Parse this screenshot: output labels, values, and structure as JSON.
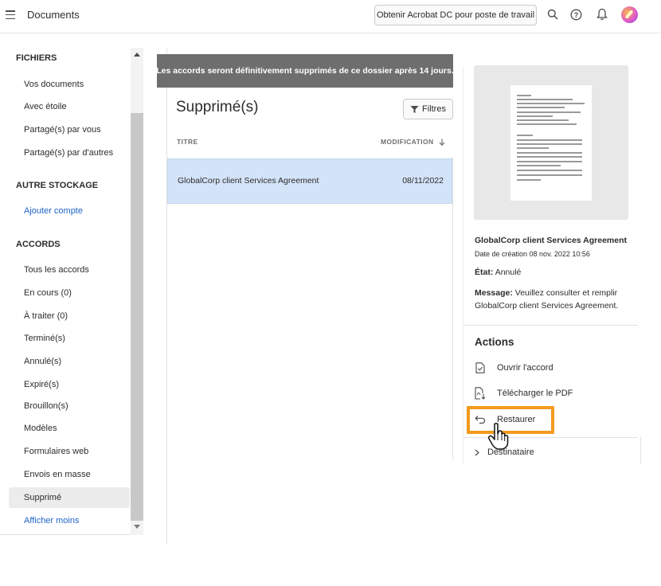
{
  "header": {
    "title": "Documents",
    "get_acrobat_label": "Obtenir Acrobat DC pour poste de travail",
    "icons": [
      "menu-icon",
      "search-icon",
      "help-icon",
      "bell-icon",
      "avatar"
    ]
  },
  "sidebar": {
    "sections": [
      {
        "title": "FICHIERS",
        "items": [
          "Vos documents",
          "Avec étoile",
          "Partagé(s) par vous",
          "Partagé(s) par d'autres"
        ]
      },
      {
        "title": "AUTRE STOCKAGE",
        "items": [
          "Ajouter compte"
        ]
      },
      {
        "title": "ACCORDS",
        "items": [
          "Tous les accords",
          "En cours (0)",
          "À traiter (0)",
          "Terminé(s)",
          "Annulé(s)",
          "Expiré(s)",
          "Brouillon(s)",
          "Modèles",
          "Formulaires web",
          "Envois en masse",
          "Supprimé",
          "Afficher moins"
        ]
      }
    ],
    "selected_item": "Supprimé"
  },
  "main": {
    "banner": "Les accords seront définitivement supprimés de ce dossier après 14 jours.",
    "title": "Supprimé(s)",
    "filter_label": "Filtres",
    "columns": {
      "title": "TITRE",
      "modified": "MODIFICATION"
    },
    "rows": [
      {
        "name": "GlobalCorp client Services Agreement",
        "date": "08/11/2022",
        "selected": true
      }
    ]
  },
  "details": {
    "name": "GlobalCorp client Services Agreement",
    "created": "Date de création 08 nov. 2022 10:56",
    "state_label": "État:",
    "state_value": "Annulé",
    "message_label": "Message:",
    "message_value": "Veuillez consulter et remplir GlobalCorp client Services Agreement.",
    "actions_title": "Actions",
    "actions": [
      {
        "label": "Ouvrir l'accord",
        "icon": "document-check-icon"
      },
      {
        "label": "Télécharger le PDF",
        "icon": "pdf-download-icon"
      },
      {
        "label": "Restaurer",
        "icon": "restore-arrow-icon"
      }
    ],
    "recipient_label": "Destinataire"
  },
  "colors": {
    "accent_link": "#1f63c6",
    "banner_bg": "#6e6e6e",
    "selected_row": "#d3e3f8",
    "highlight": "#f39a1e"
  }
}
